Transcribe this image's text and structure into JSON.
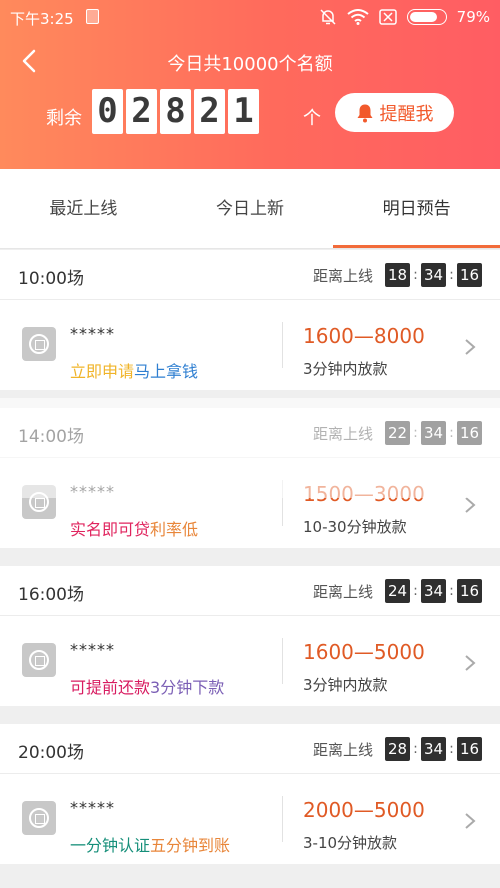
{
  "status_bar": {
    "time": "下午3:25",
    "battery": "79%",
    "battery_level": 0.79
  },
  "header": {
    "title": "今日共10000个名额",
    "remain_label": "剩余",
    "digits": [
      "0",
      "2",
      "8",
      "2",
      "1"
    ],
    "unit": "个",
    "remind_label": "提醒我"
  },
  "tabs": [
    {
      "label": "最近上线"
    },
    {
      "label": "今日上新"
    },
    {
      "label": "明日预告"
    }
  ],
  "sessions": [
    {
      "time": "10:00场",
      "countdown_label": "距离上线",
      "h": "18",
      "m": "34",
      "s": "16",
      "product": {
        "name": "*****",
        "tag1": "立即申请",
        "tag1_color": "#f0b429",
        "tag2": "马上拿钱",
        "tag2_color": "#2f7fd1",
        "amount": "1600—8000",
        "payout": "3分钟内放款"
      }
    },
    {
      "time": "14:00场",
      "countdown_label": "距离上线",
      "h": "22",
      "m": "34",
      "s": "16",
      "product": {
        "name": "*****",
        "tag1": "实名即可贷",
        "tag1_color": "#e0245e",
        "tag2": "利率低",
        "tag2_color": "#e8863a",
        "amount": "1500—3000",
        "payout": "10-30分钟放款"
      }
    },
    {
      "time": "16:00场",
      "countdown_label": "距离上线",
      "h": "24",
      "m": "34",
      "s": "16",
      "product": {
        "name": "*****",
        "tag1": "可提前还款",
        "tag1_color": "#d81b60",
        "tag2": "3分钟下款",
        "tag2_color": "#7b5fb5",
        "amount": "1600—5000",
        "payout": "3分钟内放款"
      }
    },
    {
      "time": "20:00场",
      "countdown_label": "距离上线",
      "h": "28",
      "m": "34",
      "s": "16",
      "product": {
        "name": "*****",
        "tag1": "一分钟认证",
        "tag1_color": "#168f7a",
        "tag2": "五分钟到账",
        "tag2_color": "#e8863a",
        "amount": "2000—5000",
        "payout": "3-10分钟放款"
      }
    }
  ]
}
